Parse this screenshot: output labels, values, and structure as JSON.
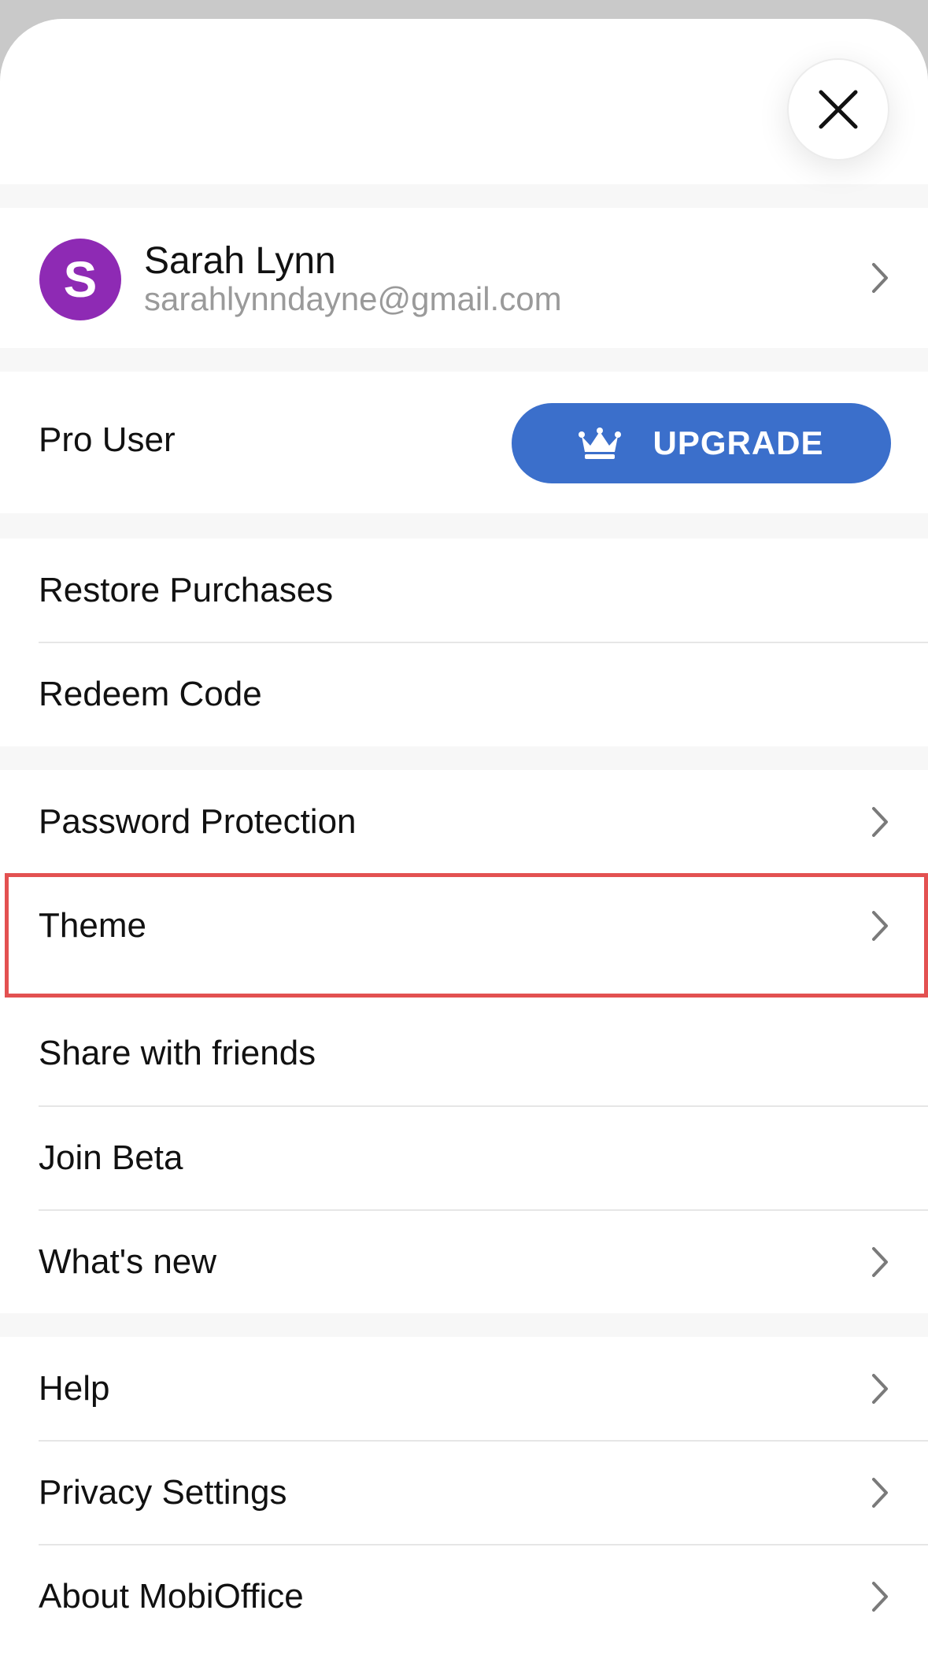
{
  "account": {
    "avatar_letter": "S",
    "name": "Sarah Lynn",
    "email": "sarahlynndayne@gmail.com"
  },
  "subscription": {
    "status_label": "Pro User",
    "upgrade_label": "UPGRADE"
  },
  "purchases": {
    "restore_label": "Restore Purchases",
    "redeem_label": "Redeem Code"
  },
  "settings": {
    "password_label": "Password Protection",
    "theme_label": "Theme",
    "share_label": "Share with friends",
    "beta_label": "Join Beta",
    "whats_new_label": "What's new"
  },
  "support": {
    "help_label": "Help",
    "privacy_label": "Privacy Settings",
    "about_label": "About MobiOffice"
  },
  "colors": {
    "avatar": "#8e2ab4",
    "upgrade_button": "#3b6fcb",
    "highlight": "#e35151"
  },
  "icons": {
    "close": "close-icon",
    "chevron": "chevron-right-icon",
    "crown": "crown-icon"
  }
}
